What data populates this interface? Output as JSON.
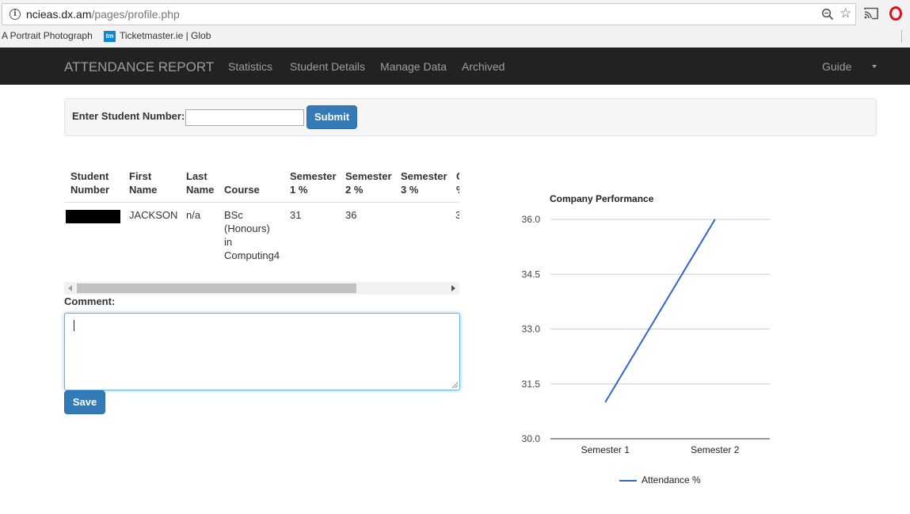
{
  "browser": {
    "url_host": "ncieas.dx.am",
    "url_path": "/pages/profile.php",
    "bookmarks": [
      {
        "label": "A Portrait Photograph"
      },
      {
        "label": "Ticketmaster.ie | Glob",
        "icon_text": "tm"
      }
    ]
  },
  "navbar": {
    "brand": "ATTENDANCE REPORT",
    "items": [
      "Statistics",
      "Student Details",
      "Manage Data",
      "Archived"
    ],
    "guide": "Guide"
  },
  "search": {
    "label": "Enter Student Number:",
    "value": "",
    "submit_label": "Submit"
  },
  "table": {
    "headers": [
      [
        "Student",
        "Number"
      ],
      [
        "First",
        "Name"
      ],
      [
        "Last",
        "Name"
      ],
      [
        "",
        "Course"
      ],
      [
        "Semester",
        "1 %"
      ],
      [
        "Semester",
        "2 %"
      ],
      [
        "Semester",
        "3 %"
      ],
      [
        "C",
        "%"
      ]
    ],
    "rows": [
      {
        "student_number": "",
        "first_name": "JACKSON",
        "last_name": "n/a",
        "course": [
          "BSc",
          "(Honours)",
          "in",
          "Computing4"
        ],
        "sem1": "31",
        "sem2": "36",
        "sem3": "",
        "cut": "3"
      }
    ]
  },
  "comment": {
    "label": "Comment:",
    "value": "",
    "save_label": "Save"
  },
  "chart_data": {
    "type": "line",
    "title": "Company Performance",
    "categories": [
      "Semester 1",
      "Semester 2"
    ],
    "series": [
      {
        "name": "Attendance %",
        "values": [
          31,
          36
        ],
        "color": "#3366cc"
      }
    ],
    "ylim": [
      30,
      36
    ],
    "yticks": [
      "30.0",
      "31.5",
      "33.0",
      "34.5",
      "36.0"
    ],
    "legend": "bottom",
    "grid": true
  }
}
